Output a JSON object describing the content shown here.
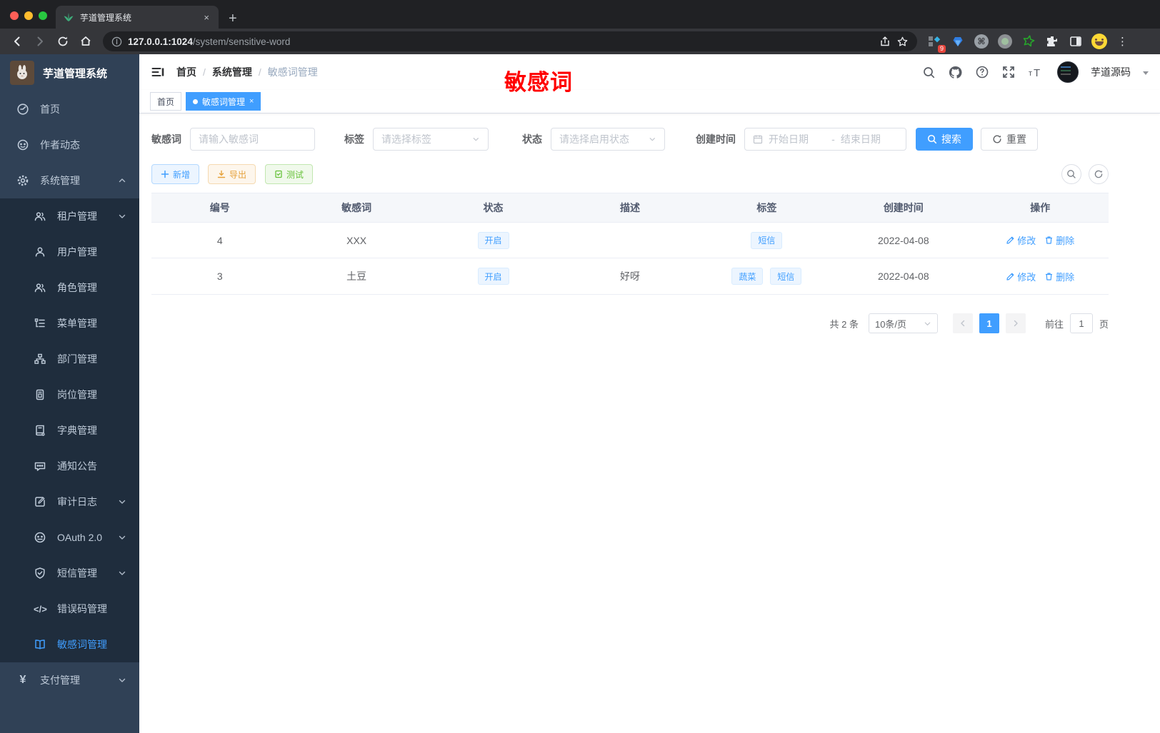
{
  "colors": {
    "accent": "#409eff",
    "sidebar_bg": "#304156",
    "submenu_bg": "#1f2d3d",
    "sidebar_text": "#bfcbd9",
    "annotation_red": "#ff0000",
    "tag_bg": "#ecf5ff",
    "warning": "#e6a23c",
    "success": "#67c23a"
  },
  "browser": {
    "tab_title": "芋道管理系统",
    "close_tab": "×",
    "new_tab": "+",
    "url_host": "127.0.0.1:1024",
    "url_path": "/system/sensitive-word",
    "extension_badge": "9"
  },
  "sidebar": {
    "app_title": "芋道管理系统",
    "items": [
      {
        "label": "首页",
        "icon": "dashboard-icon"
      },
      {
        "label": "作者动态",
        "icon": "author-icon"
      },
      {
        "label": "系统管理",
        "icon": "gear-icon",
        "arrow": "up"
      },
      {
        "label": "租户管理",
        "icon": "tenant-icon",
        "arrow": "down"
      },
      {
        "label": "用户管理",
        "icon": "user-icon"
      },
      {
        "label": "角色管理",
        "icon": "role-icon"
      },
      {
        "label": "菜单管理",
        "icon": "menu-tree-icon"
      },
      {
        "label": "部门管理",
        "icon": "department-icon"
      },
      {
        "label": "岗位管理",
        "icon": "post-icon"
      },
      {
        "label": "字典管理",
        "icon": "dictionary-icon"
      },
      {
        "label": "通知公告",
        "icon": "notice-icon"
      },
      {
        "label": "审计日志",
        "icon": "audit-log-icon",
        "arrow": "down"
      },
      {
        "label": "OAuth 2.0",
        "icon": "oauth-icon",
        "arrow": "down"
      },
      {
        "label": "短信管理",
        "icon": "sms-shield-icon",
        "arrow": "down"
      },
      {
        "label": "错误码管理",
        "icon": "error-code-icon",
        "code_glyph": "</>"
      },
      {
        "label": "敏感词管理",
        "icon": "open-book-icon",
        "active": true
      },
      {
        "label": "支付管理",
        "icon": "yen-icon",
        "yen_glyph": "¥",
        "arrow": "down"
      }
    ]
  },
  "header": {
    "breadcrumbs": [
      "首页",
      "系统管理",
      "敏感词管理"
    ],
    "separator": "/",
    "user_name": "芋道源码",
    "annotation": "敏感词"
  },
  "view_tabs": [
    {
      "label": "首页",
      "active": false
    },
    {
      "label": "敏感词管理",
      "active": true,
      "close": "×"
    }
  ],
  "filters": {
    "keyword": {
      "label": "敏感词",
      "placeholder": "请输入敏感词"
    },
    "tag": {
      "label": "标签",
      "placeholder": "请选择标签"
    },
    "status": {
      "label": "状态",
      "placeholder": "请选择启用状态"
    },
    "create_time": {
      "label": "创建时间",
      "start_placeholder": "开始日期",
      "separator": "-",
      "end_placeholder": "结束日期"
    },
    "search_label": "搜索",
    "reset_label": "重置"
  },
  "toolbar": {
    "add_label": "新增",
    "export_label": "导出",
    "test_label": "测试"
  },
  "table": {
    "columns": [
      "编号",
      "敏感词",
      "状态",
      "描述",
      "标签",
      "创建时间",
      "操作"
    ],
    "rows": [
      {
        "id": "4",
        "word": "XXX",
        "status": "开启",
        "description": "",
        "tags": [
          "短信"
        ],
        "create_time": "2022-04-08",
        "edit_label": "修改",
        "delete_label": "删除"
      },
      {
        "id": "3",
        "word": "土豆",
        "status": "开启",
        "description": "好呀",
        "tags": [
          "蔬菜",
          "短信"
        ],
        "create_time": "2022-04-08",
        "edit_label": "修改",
        "delete_label": "删除"
      }
    ]
  },
  "pagination": {
    "total_text": "共 2 条",
    "page_size": "10条/页",
    "current_page": "1",
    "goto_label": "前往",
    "goto_value": "1",
    "page_unit": "页"
  }
}
